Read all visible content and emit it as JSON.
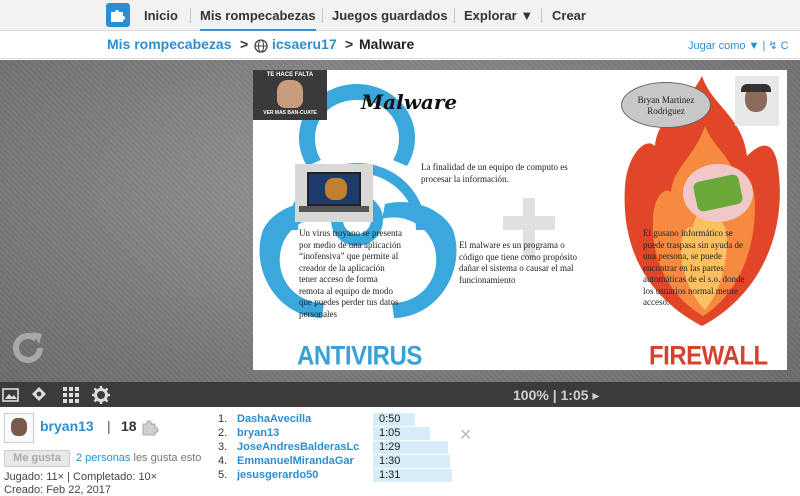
{
  "nav": {
    "items": [
      "Inicio",
      "Mis rompecabezas",
      "Juegos guardados",
      "Explorar ▼",
      "Crear"
    ]
  },
  "breadcrumb": {
    "root": "Mis rompecabezas",
    "sep1": ">",
    "folder": "icsaeru17",
    "sep2": ">",
    "current": "Malware"
  },
  "play_as": "Jugar como ▼ | ↯ C",
  "puzzle": {
    "title": "Malware",
    "meme_top": "TE HACE FALTA",
    "meme_bottom": "VER MAS BAN-CUATE",
    "author": "Bryan Martinez Rodriguez",
    "text_purpose": "La finalidad  de un equipo de computo es procesar la información.",
    "text_trojan": "Un  virus troyano se presenta por medio de una aplicación “inofensiva” que permite al creador de la aplicación tener acceso de forma remota al equipo de modo que puedes perder tus datos personales",
    "text_malware": "El malware es un programa o código  que tiene como propósito dañar el sistema o causar el  mal funcionamiento",
    "text_worm": "El gusano informático se puede traspasa sin ayuda de una persona, se puede encontrar en las  partes automáticas de el s.o. donde los usuarios normal mente acceso.",
    "antivirus": "ANTIVIRUS",
    "firewall": "FIREWALL"
  },
  "controls": {
    "zoom_time": "100% | 1:05 ▸"
  },
  "user": {
    "name": "bryan13",
    "pipe": "|",
    "count": "18"
  },
  "like": {
    "button": "Me gusta",
    "people": "2 personas",
    "rest": " les gusta esto"
  },
  "stats": {
    "line1": "Jugado: 11× | Completado: 10×",
    "line2": "Creado: Feb 22, 2017"
  },
  "leaderboard": [
    {
      "rank": "1.",
      "name": "DashaAvecilla",
      "time": "0:50",
      "fraction": 0.38
    },
    {
      "rank": "2.",
      "name": "bryan13",
      "time": "1:05",
      "fraction": 0.52
    },
    {
      "rank": "3.",
      "name": "JoseAndresBalderasLc",
      "time": "1:29",
      "fraction": 0.68
    },
    {
      "rank": "4.",
      "name": "EmmanuelMirandaGar",
      "time": "1:30",
      "fraction": 0.7
    },
    {
      "rank": "5.",
      "name": "jesusgerardo50",
      "time": "1:31",
      "fraction": 0.72
    }
  ],
  "colors": {
    "link": "#2a8fd0",
    "bar": "#d6ecf9",
    "control_bar": "#3b3b3b"
  }
}
